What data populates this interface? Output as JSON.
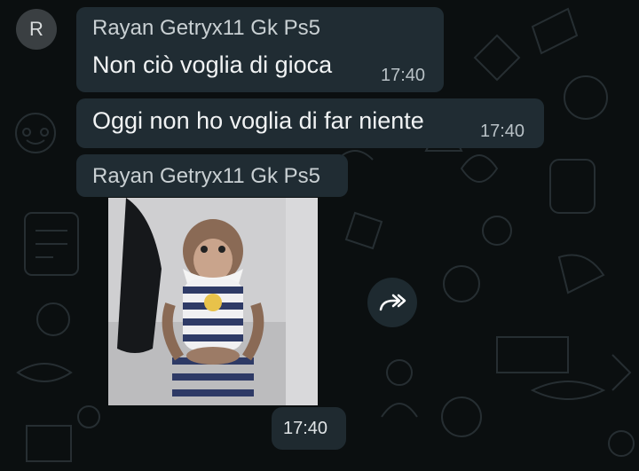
{
  "messages": [
    {
      "sender": "Rayan Getryx11 Gk Ps5",
      "text": "Non ciò voglia di gioca",
      "time": "17:40"
    },
    {
      "text": "Oggi non ho voglia di far niente",
      "time": "17:40"
    },
    {
      "sender": "Rayan Getryx11 Gk Ps5",
      "media": "monkey-gif",
      "time": "17:40"
    }
  ],
  "avatar": {
    "initial": "R"
  },
  "icons": {
    "forward": "forward-icon"
  },
  "colors": {
    "background": "#0b0f10",
    "bubble": "#202c33",
    "text": "#e9edef"
  }
}
